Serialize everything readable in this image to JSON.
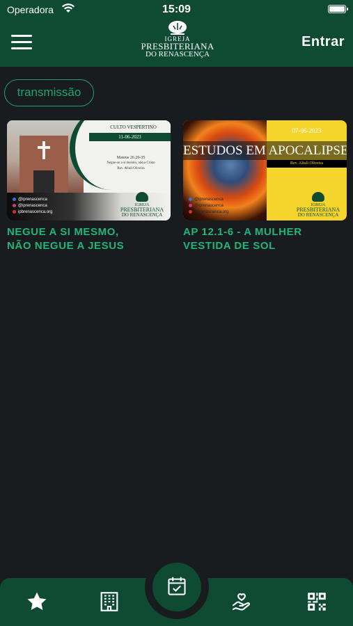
{
  "status_bar": {
    "carrier": "Operadora",
    "time": "15:09"
  },
  "header": {
    "logo": {
      "line1": "IGREJA",
      "line2": "PRESBITERIANA",
      "line3": "DO RENASCENÇA"
    },
    "login_label": "Entrar"
  },
  "filter_chip": {
    "label": "transmissão"
  },
  "cards": [
    {
      "title_line1": "NEGUE A SI MESMO,",
      "title_line2": "NÃO NEGUE A JESUS",
      "thumb": {
        "header": "CULTO VESPERTINO",
        "date": "11-06-2023",
        "ref": "Mateus 26.20-35",
        "subtitle": "Negue-se a si mesmo, não a Cristo",
        "preacher": "Rev. Aliuli Oliveira",
        "social": [
          "@iprenascenca",
          "@iprenascenca",
          "ipbrenascenca.org"
        ],
        "brand": [
          "IGREJA",
          "PRESBITERIANA",
          "DO RENASCENÇA"
        ]
      }
    },
    {
      "title_line1": "AP 12.1-6 - A MULHER",
      "title_line2": "VESTIDA DE SOL",
      "thumb": {
        "date": "07-06-2023",
        "title": "ESTUDOS EM APOCALIPSE",
        "preacher": "Rev. Aliuli Oliveira",
        "social": [
          "@iprenascenca",
          "@iprenascenca",
          "ipbrenascenca.org"
        ],
        "brand": [
          "IGREJA",
          "PRESBITERIANA",
          "DO RENASCENÇA"
        ]
      }
    }
  ],
  "tab_bar": {
    "items": [
      {
        "icon": "star-icon"
      },
      {
        "icon": "building-icon"
      },
      {
        "icon": "calendar-check-icon",
        "active": true
      },
      {
        "icon": "hand-heart-icon"
      },
      {
        "icon": "qr-code-icon"
      }
    ]
  },
  "colors": {
    "brand_green": "#0f4a33",
    "accent_green": "#21b57a",
    "background": "#181c1f"
  }
}
